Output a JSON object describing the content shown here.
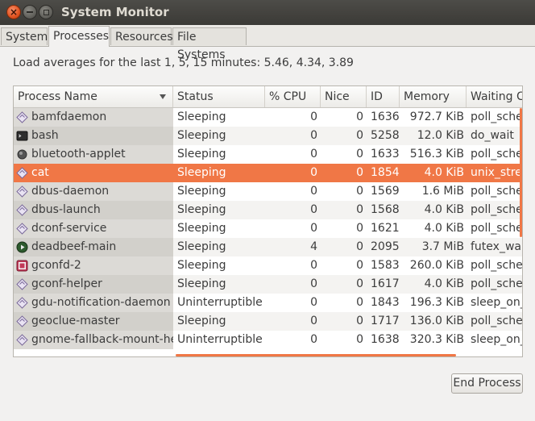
{
  "window": {
    "title": "System Monitor"
  },
  "tabs": [
    {
      "label": "System"
    },
    {
      "label": "Processes"
    },
    {
      "label": "Resources"
    },
    {
      "label": "File Systems"
    }
  ],
  "active_tab": "Processes",
  "load_text": "Load averages for the last 1, 5, 15 minutes: 5.46, 4.34, 3.89",
  "columns": [
    "Process Name",
    "Status",
    "% CPU",
    "Nice",
    "ID",
    "Memory",
    "Waiting C"
  ],
  "sort": {
    "column": "Process Name",
    "direction": "descending-arrow"
  },
  "rows": [
    {
      "icon": "diamond-icon",
      "name": "bamfdaemon",
      "status": "Sleeping",
      "cpu": "0",
      "nice": "0",
      "id": "1636",
      "memory": "972.7 KiB",
      "wait": "poll_sched"
    },
    {
      "icon": "terminal-icon",
      "name": "bash",
      "status": "Sleeping",
      "cpu": "0",
      "nice": "0",
      "id": "5258",
      "memory": "12.0 KiB",
      "wait": "do_wait"
    },
    {
      "icon": "bluetooth-icon",
      "name": "bluetooth-applet",
      "status": "Sleeping",
      "cpu": "0",
      "nice": "0",
      "id": "1633",
      "memory": "516.3 KiB",
      "wait": "poll_sched"
    },
    {
      "icon": "diamond-icon",
      "name": "cat",
      "status": "Sleeping",
      "cpu": "0",
      "nice": "0",
      "id": "1854",
      "memory": "4.0 KiB",
      "wait": "unix_strea",
      "selected": true
    },
    {
      "icon": "diamond-icon",
      "name": "dbus-daemon",
      "status": "Sleeping",
      "cpu": "0",
      "nice": "0",
      "id": "1569",
      "memory": "1.6 MiB",
      "wait": "poll_sched"
    },
    {
      "icon": "diamond-icon",
      "name": "dbus-launch",
      "status": "Sleeping",
      "cpu": "0",
      "nice": "0",
      "id": "1568",
      "memory": "4.0 KiB",
      "wait": "poll_sched"
    },
    {
      "icon": "diamond-icon",
      "name": "dconf-service",
      "status": "Sleeping",
      "cpu": "0",
      "nice": "0",
      "id": "1621",
      "memory": "4.0 KiB",
      "wait": "poll_sched"
    },
    {
      "icon": "play-icon",
      "name": "deadbeef-main",
      "status": "Sleeping",
      "cpu": "4",
      "nice": "0",
      "id": "2095",
      "memory": "3.7 MiB",
      "wait": "futex_wai"
    },
    {
      "icon": "gconf-icon",
      "name": "gconfd-2",
      "status": "Sleeping",
      "cpu": "0",
      "nice": "0",
      "id": "1583",
      "memory": "260.0 KiB",
      "wait": "poll_sched"
    },
    {
      "icon": "diamond-icon",
      "name": "gconf-helper",
      "status": "Sleeping",
      "cpu": "0",
      "nice": "0",
      "id": "1617",
      "memory": "4.0 KiB",
      "wait": "poll_sched"
    },
    {
      "icon": "diamond-icon",
      "name": "gdu-notification-daemon",
      "status": "Uninterruptible",
      "cpu": "0",
      "nice": "0",
      "id": "1843",
      "memory": "196.3 KiB",
      "wait": "sleep_on_"
    },
    {
      "icon": "diamond-icon",
      "name": "geoclue-master",
      "status": "Sleeping",
      "cpu": "0",
      "nice": "0",
      "id": "1717",
      "memory": "136.0 KiB",
      "wait": "poll_sched"
    },
    {
      "icon": "diamond-icon",
      "name": "gnome-fallback-mount-hel",
      "status": "Uninterruptible",
      "cpu": "0",
      "nice": "0",
      "id": "1638",
      "memory": "320.3 KiB",
      "wait": "sleep_on_"
    }
  ],
  "end_process_label": "End Process",
  "colors": {
    "accent": "#f07746",
    "titlebar": "#3c3b37"
  }
}
